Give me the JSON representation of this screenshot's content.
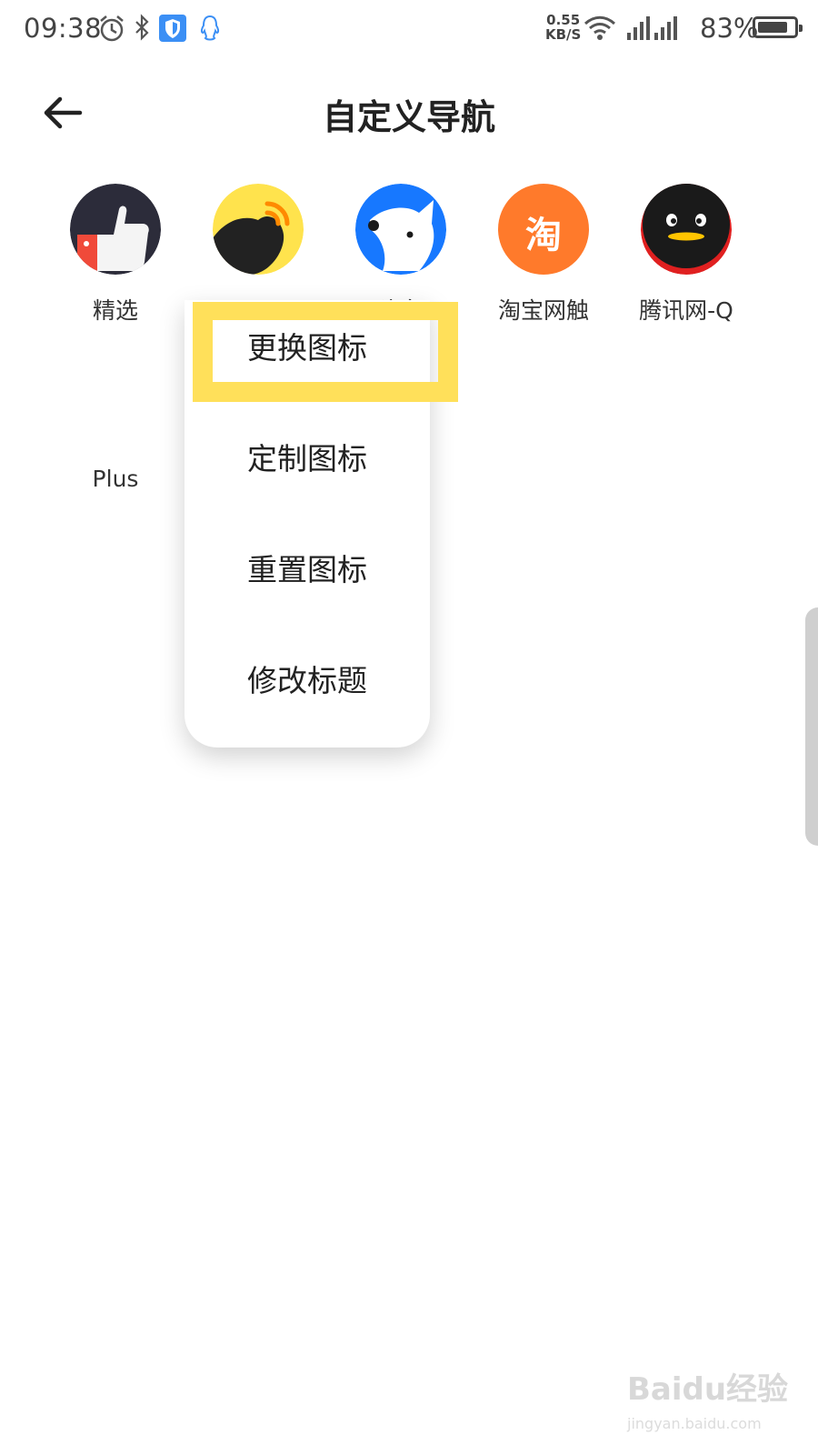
{
  "status_bar": {
    "time": "09:38",
    "speed_value": "0.55",
    "speed_unit": "KB/S",
    "battery": "83%",
    "battery_level": 0.83
  },
  "header": {
    "title": "自定义导航"
  },
  "nav_items": [
    {
      "label": "精选"
    },
    {
      "label": ""
    },
    {
      "label": "头条"
    },
    {
      "label": "淘宝网触"
    },
    {
      "label": "腾讯网-Q"
    }
  ],
  "second_row": {
    "label": "Plus"
  },
  "context_menu": {
    "items": [
      "更换图标",
      "定制图标",
      "重置图标",
      "修改标题"
    ],
    "highlight_color": "#ffe05a"
  },
  "icon_badges": {
    "taobao": "淘"
  },
  "watermark": {
    "brand": "Baidu经验",
    "url": "jingyan.baidu.com"
  },
  "colors": {
    "accent_yellow": "#ffe05a",
    "taobao_orange": "#ff7a2b",
    "blue": "#1778ff"
  }
}
